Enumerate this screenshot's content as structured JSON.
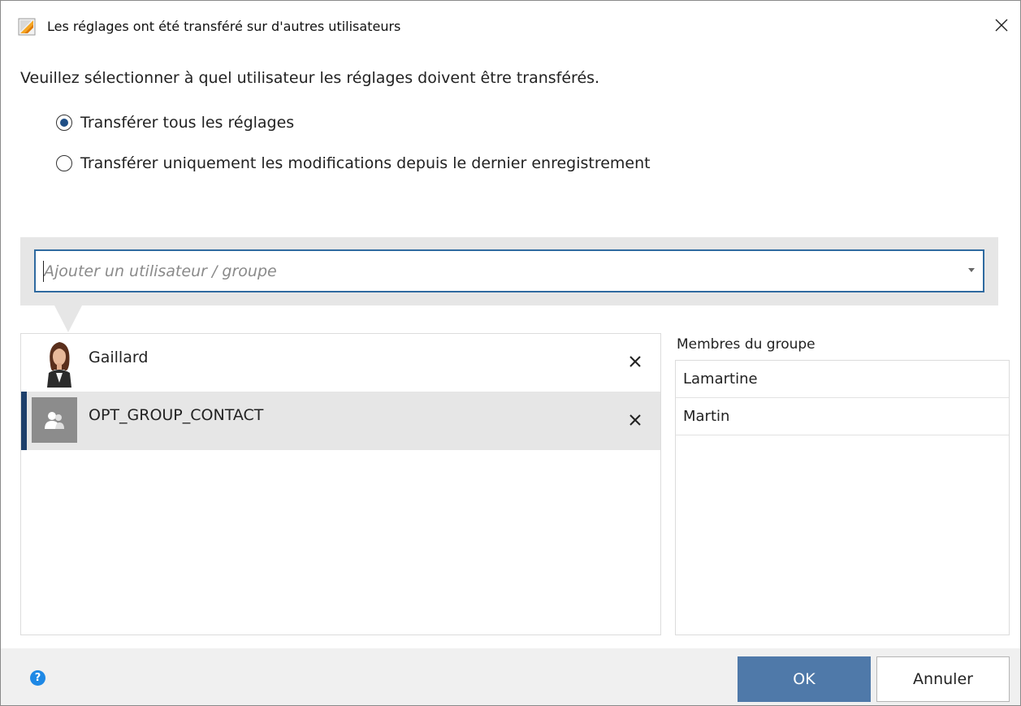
{
  "window": {
    "title": "Les réglages ont été transféré sur d'autres utilisateurs"
  },
  "instruction": "Veuillez sélectionner à quel utilisateur les réglages doivent être transférés.",
  "options": [
    {
      "label": "Transférer tous les réglages",
      "selected": true
    },
    {
      "label": "Transférer uniquement les modifications depuis le dernier enregistrement",
      "selected": false
    }
  ],
  "search": {
    "value": "",
    "placeholder": "Ajouter un utilisateur / groupe"
  },
  "users": [
    {
      "name": "Gaillard",
      "type": "user",
      "selected": false,
      "avatar": "user-photo"
    },
    {
      "name": "OPT_GROUP_CONTACT",
      "type": "group",
      "selected": true,
      "avatar": "group-icon"
    }
  ],
  "group_members": {
    "label": "Membres du groupe",
    "items": [
      "Lamartine",
      "Martin"
    ]
  },
  "footer": {
    "help_icon": "help-icon",
    "ok_label": "OK",
    "cancel_label": "Annuler"
  },
  "colors": {
    "accent": "#2f6aa0",
    "ok_button": "#4f79a9",
    "selection_bar": "#1d3f6b",
    "band": "#e6e6e6",
    "help": "#1e88e5"
  }
}
